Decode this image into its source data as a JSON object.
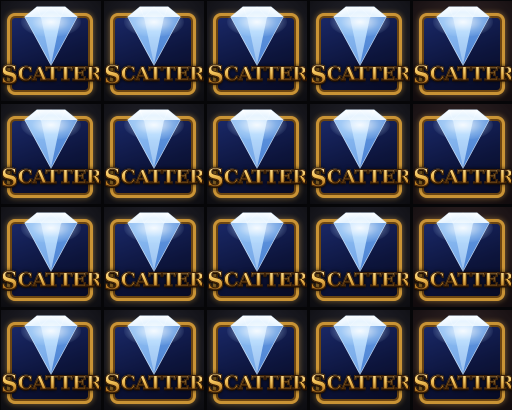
{
  "board": {
    "rows": 4,
    "columns": 5,
    "symbols": [
      [
        "SCATTER",
        "SCATTER",
        "SCATTER",
        "SCATTER",
        "SCATTER"
      ],
      [
        "SCATTER",
        "SCATTER",
        "SCATTER",
        "SCATTER",
        "SCATTER"
      ],
      [
        "SCATTER",
        "SCATTER",
        "SCATTER",
        "SCATTER",
        "SCATTER"
      ],
      [
        "SCATTER",
        "SCATTER",
        "SCATTER",
        "SCATTER",
        "SCATTER"
      ]
    ]
  },
  "colors": {
    "frame_gold": "#c99335",
    "frame_blue": "#1b2a6b",
    "diamond_light": "#e8f4ff",
    "diamond_blue": "#5a9ae8",
    "label_gold": "#f3c35a"
  },
  "icons": {
    "symbol": "diamond-icon"
  }
}
